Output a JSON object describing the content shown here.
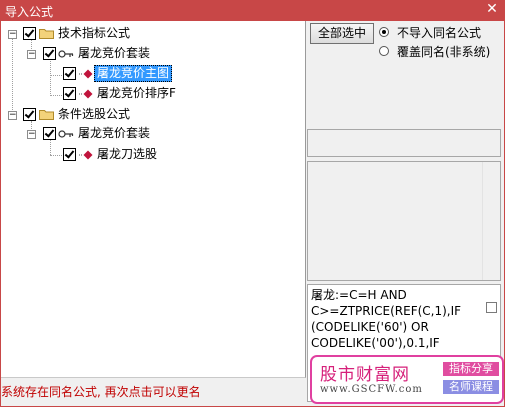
{
  "window": {
    "title": "导入公式",
    "close_glyph": "✕"
  },
  "tree": {
    "groups": [
      {
        "label": "技术指标公式",
        "suite": "屠龙竞价套装",
        "items": [
          "屠龙竞价主图",
          "屠龙竞价排序F"
        ]
      },
      {
        "label": "条件选股公式",
        "suite": "屠龙竞价套装",
        "items": [
          "屠龙刀选股"
        ]
      }
    ],
    "selected_item": "屠龙竞价主图"
  },
  "options": {
    "select_all_label": "全部选中",
    "radio_skip_label": "不导入同名公式",
    "radio_overwrite_label": "覆盖同名(非系统)",
    "selected_radio": "skip"
  },
  "formula_preview": "屠龙:=C=H AND C>=ZTPRICE(REF(C,1),IF (CODELIKE('60') OR CODELIKE('00'),0.1,IF",
  "status_text": "系统存在同名公式, 再次点击可以更名",
  "watermark": {
    "name": "股市财富网",
    "url": "www.GSCFW.com",
    "tag1": "指标分享",
    "tag2": "名师课程"
  },
  "colors": {
    "title_bar": "#c84747",
    "selection": "#3399ff",
    "status_text": "#c00000",
    "watermark_accent": "#e040a0"
  }
}
